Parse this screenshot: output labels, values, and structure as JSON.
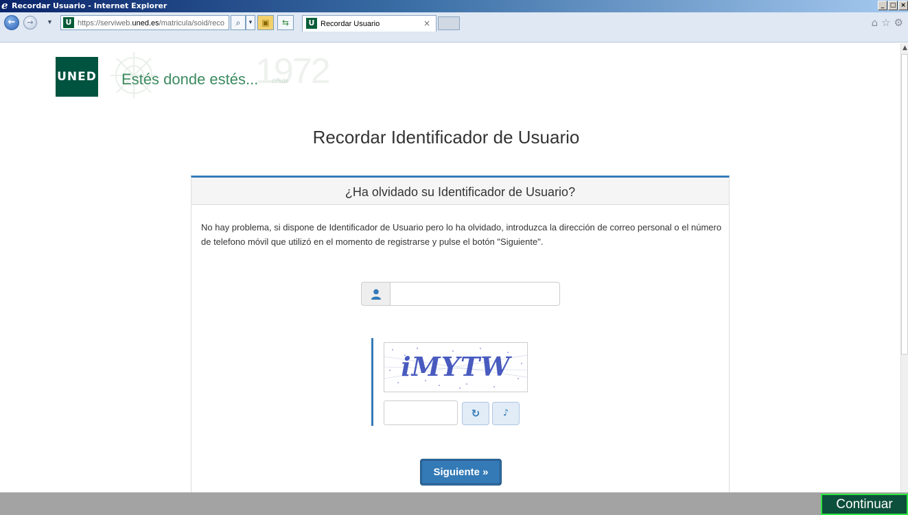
{
  "window": {
    "title": "Recordar Usuario - Internet Explorer",
    "minimize": "_",
    "maximize": "□",
    "close": "×"
  },
  "browser": {
    "url_prefix": "https://serviweb.",
    "url_domain": "uned.es",
    "url_path": "/matricula/soid/reco",
    "tab_label": "Recordar Usuario",
    "tab_close": "×",
    "site_favicon_letter": "U",
    "search_glyph": "⌕",
    "dropdown_glyph": "▾",
    "lock_glyph": "▣",
    "refresh_glyph": "⇆",
    "right_icons": "⌂☆⚙"
  },
  "header": {
    "logo_text": "UNED",
    "slogan": "Estés donde estés...",
    "desde": "desde",
    "year": "1972"
  },
  "page": {
    "title": "Recordar Identificador de Usuario"
  },
  "panel": {
    "heading": "¿Ha olvidado su Identificador de Usuario?",
    "intro": "No hay problema, si dispone de Identificador de Usuario pero lo ha olvidado, introduzca la dirección de correo personal o el número de telefono móvil que utilizó en el momento de registrarse y pulse el botón \"Siguiente\".",
    "identifier_value": "",
    "captcha_text": "iMYTW",
    "captcha_value": "",
    "refresh_glyph": "↻",
    "audio_glyph": "♪",
    "next_label": "Siguiente »"
  },
  "footer": {
    "continue_label": "Continuar"
  },
  "colors": {
    "brand_green": "#00533e",
    "primary_blue": "#337ab7",
    "highlight_green": "#2ee53f"
  }
}
